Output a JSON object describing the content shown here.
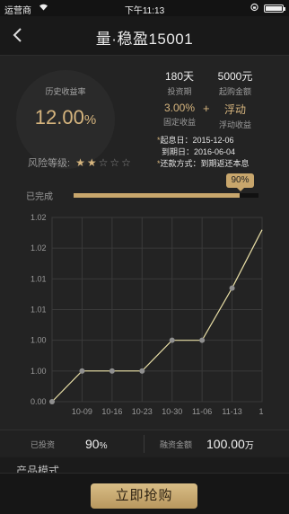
{
  "status_bar": {
    "carrier": "运营商",
    "time": "下午11:13"
  },
  "nav": {
    "title": "量·稳盈15001"
  },
  "summary": {
    "rate_label": "历史收益率",
    "rate_value": "12.00",
    "rate_unit": "%",
    "risk_label": "风险等级:",
    "risk_level": 2,
    "risk_max": 5,
    "term_value": "180天",
    "term_label": "投资期",
    "min_value": "5000元",
    "min_label": "起购金额",
    "fixed_value": "3.00%",
    "fixed_label": "固定收益",
    "plus": "+",
    "float_value": "浮动",
    "float_label": "浮动收益",
    "info": [
      {
        "star": "*",
        "text": "起息日：2015-12-06"
      },
      {
        "star": "",
        "text": "到期日：2016-06-04"
      },
      {
        "star": "*",
        "text": "还款方式：到期返还本息"
      }
    ]
  },
  "progress": {
    "label": "已完成",
    "value": 0.9,
    "bubble": "90%"
  },
  "chart_data": {
    "type": "line",
    "x": [
      "",
      "10-09",
      "10-16",
      "10-23",
      "10-30",
      "11-06",
      "11-13",
      "1"
    ],
    "y_ticks": [
      "1.02",
      "1.02",
      "1.01",
      "1.01",
      "1.00",
      "1.00",
      "0.00"
    ],
    "values": [
      0.0,
      1.0,
      1.0,
      1.0,
      2.0,
      2.0,
      3.7,
      5.6
    ],
    "markers": [
      true,
      true,
      true,
      true,
      true,
      true,
      true,
      false
    ],
    "ylim": [
      0,
      6
    ],
    "line_color": "#e9dfa6",
    "grid": true
  },
  "stats_row": {
    "invested_label": "已投资",
    "invested_value": "90",
    "invested_unit": "%",
    "amount_label": "融资金额",
    "amount_value": "100.00",
    "amount_unit": "万"
  },
  "section": {
    "title": "产品模式"
  },
  "footer": {
    "buy_label": "立即抢购"
  },
  "colors": {
    "gold": "#d6b57e",
    "background": "#1f1f1f"
  }
}
